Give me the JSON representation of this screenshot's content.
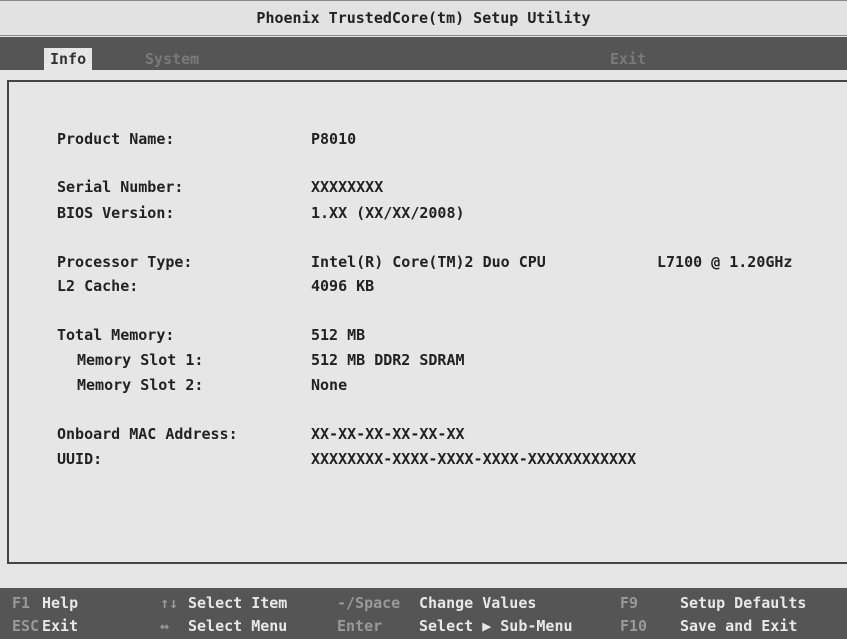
{
  "title": "Phoenix TrustedCore(tm) Setup Utility",
  "menu": [
    {
      "label": "Info"
    },
    {
      "label": "System"
    },
    {
      "label": "Exit"
    }
  ],
  "info": {
    "product_name_label": "Product Name:",
    "product_name": "P8010",
    "serial_number_label": "Serial Number:",
    "serial_number": "XXXXXXXX",
    "bios_version_label": "BIOS Version:",
    "bios_version": "1.XX (XX/XX/2008)",
    "processor_type_label": "Processor Type:",
    "processor_type": "Intel(R) Core(TM)2 Duo CPU",
    "processor_speed": "L7100 @ 1.20GHz",
    "l2_cache_label": "L2 Cache:",
    "l2_cache": "4096 KB",
    "total_memory_label": "Total Memory:",
    "total_memory": "512 MB",
    "memory_slot1_label": "Memory Slot 1:",
    "memory_slot1": "512 MB DDR2 SDRAM",
    "memory_slot2_label": "Memory Slot 2:",
    "memory_slot2": "None",
    "mac_label": "Onboard MAC Address:",
    "mac": "XX-XX-XX-XX-XX-XX",
    "uuid_label": "UUID:",
    "uuid": "XXXXXXXX-XXXX-XXXX-XXXX-XXXXXXXXXXXX"
  },
  "footer": [
    {
      "key": "F1",
      "desc": "Help"
    },
    {
      "key": "↑↓",
      "desc": "Select Item"
    },
    {
      "key": "-/Space",
      "desc": "Change Values"
    },
    {
      "key": "F9",
      "desc": "Setup Defaults"
    },
    {
      "key": "ESC",
      "desc": "Exit"
    },
    {
      "key": "↔",
      "desc": "Select Menu"
    },
    {
      "key": "Enter",
      "desc": "Select ▶ Sub-Menu"
    },
    {
      "key": "F10",
      "desc": "Save and Exit"
    }
  ],
  "colors": {
    "menubar_bg": "#555555",
    "panel_bg": "#e6e6e6",
    "footer_key": "#999999",
    "footer_text": "#e8e8e8"
  }
}
